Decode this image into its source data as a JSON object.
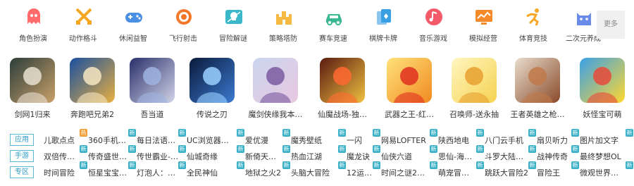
{
  "categories": [
    {
      "label": "角色扮演",
      "icon": "ghost-icon",
      "color": "#ff6b6b"
    },
    {
      "label": "动作格斗",
      "icon": "crossed-swords-icon",
      "color": "#f5a623"
    },
    {
      "label": "休闲益智",
      "icon": "gamepad-icon",
      "color": "#4a90e2"
    },
    {
      "label": "飞行射击",
      "icon": "target-icon",
      "color": "#f5782a"
    },
    {
      "label": "冒险解谜",
      "icon": "skull-map-icon",
      "color": "#3bb8c9"
    },
    {
      "label": "策略塔防",
      "icon": "castle-icon",
      "color": "#f5b942"
    },
    {
      "label": "赛车竞速",
      "icon": "car-icon",
      "color": "#3ab891"
    },
    {
      "label": "棋牌卡牌",
      "icon": "cards-icon",
      "color": "#3a9ee2"
    },
    {
      "label": "音乐游戏",
      "icon": "music-note-icon",
      "color": "#f25a6a"
    },
    {
      "label": "模拟经营",
      "icon": "monitor-chart-icon",
      "color": "#f58a2a"
    },
    {
      "label": "体育竞技",
      "icon": "runner-icon",
      "color": "#f5a623"
    },
    {
      "label": "二次元养成",
      "icon": "cat-icon",
      "color": "#6a8be8"
    }
  ],
  "more_label": "更多",
  "games": [
    {
      "name": "剑网1归来",
      "palette": [
        "#2c3e3a",
        "#c9a06a",
        "#e8e0d0"
      ]
    },
    {
      "name": "奔跑吧兄弟2",
      "palette": [
        "#1a4fa0",
        "#e8b040",
        "#f5e6c0"
      ]
    },
    {
      "name": "吾当道",
      "palette": [
        "#2a2f6a",
        "#d0d4e8",
        "#9fb3e0"
      ]
    },
    {
      "name": "传说之刃",
      "palette": [
        "#0a1a3a",
        "#3a7ad0",
        "#9ad0ff"
      ]
    },
    {
      "name": "魔剑侠缘我本…",
      "palette": [
        "#c9d6ee",
        "#e8c8e0",
        "#7a5aa0"
      ]
    },
    {
      "name": "仙魔战场-独…",
      "palette": [
        "#5a1a10",
        "#f0c040",
        "#ff6a30"
      ]
    },
    {
      "name": "武器之王-红…",
      "palette": [
        "#ffe27a",
        "#f08a20",
        "#e03020"
      ]
    },
    {
      "name": "召唤师-送永抽",
      "palette": [
        "#fff6c0",
        "#f5d250",
        "#e8a030"
      ]
    },
    {
      "name": "王者英雄之枪…",
      "palette": [
        "#e8dccc",
        "#8a4a2a",
        "#c07a4a"
      ]
    },
    {
      "name": "妖怪宝可萌",
      "palette": [
        "#3aa0e8",
        "#ffd830",
        "#e84a3a"
      ]
    }
  ],
  "rows": [
    {
      "tag": "应用",
      "links": [
        {
          "text": "儿歌点点",
          "badge": "热"
        },
        {
          "text": "360手机卫…",
          "badge": "新"
        },
        {
          "text": "每日法语…",
          "badge": "新"
        },
        {
          "text": "UC浏览器…",
          "badge": "新"
        },
        {
          "text": "爱优漫",
          "badge": "新"
        },
        {
          "text": "魔秀壁纸",
          "badge": "新"
        },
        {
          "text": "一闪",
          "badge": "新"
        },
        {
          "text": "网易LOFTER",
          "badge": "新"
        },
        {
          "text": "陕西地电",
          "badge": "新"
        },
        {
          "text": "八门云手机",
          "badge": "新"
        },
        {
          "text": "扇贝听力",
          "badge": "新"
        },
        {
          "text": "图片加文字",
          "badge": "新"
        }
      ]
    },
    {
      "tag": "手游",
      "links": [
        {
          "text": "双倍传奇BT",
          "badge": "新"
        },
        {
          "text": "传奇盛世2…",
          "badge": "新"
        },
        {
          "text": "传世霸业-…",
          "badge": "新"
        },
        {
          "text": "仙城奇缘",
          "badge": "新"
        },
        {
          "text": "新倚天屠…",
          "badge": "新"
        },
        {
          "text": "热血江湖",
          "badge": "新"
        },
        {
          "text": "魔龙诀",
          "badge": "新"
        },
        {
          "text": "仙侠六道",
          "badge": "新"
        },
        {
          "text": "思仙-海量…",
          "badge": "新"
        },
        {
          "text": "斗罗大陆…",
          "badge": "新"
        },
        {
          "text": "战神传奇",
          "badge": "新"
        },
        {
          "text": "最终梦想OL",
          "badge": ""
        }
      ]
    },
    {
      "tag": "专区",
      "links": [
        {
          "text": "时间冒险",
          "badge": "新"
        },
        {
          "text": "恒星宝宝…",
          "badge": "新"
        },
        {
          "text": "灯泡人：…",
          "badge": "新"
        },
        {
          "text": "全民神仙",
          "badge": "新"
        },
        {
          "text": "地狱之火2",
          "badge": "新"
        },
        {
          "text": "头脑大冒险",
          "badge": "新"
        },
        {
          "text": "12运算大…",
          "badge": "新"
        },
        {
          "text": "时间之谜2…",
          "badge": "新"
        },
        {
          "text": "萌宠冒险岛",
          "badge": "新"
        },
        {
          "text": "跳跃大冒险2",
          "badge": "新"
        },
        {
          "text": "冒险王",
          "badge": "新"
        },
        {
          "text": "微观世界…",
          "badge": "新"
        }
      ]
    }
  ],
  "colors": {
    "accent": "#2f9bc6",
    "tag_border": "#5fb7d8",
    "badge_new": "#3ab0c6",
    "badge_hot": "#f39c33"
  }
}
